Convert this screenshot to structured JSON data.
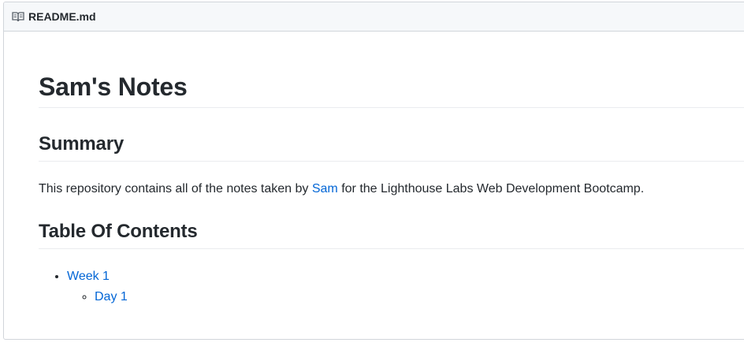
{
  "readme": {
    "filename": "README.md",
    "icon": "book-icon"
  },
  "content": {
    "title": "Sam's Notes",
    "summary_heading": "Summary",
    "summary_before": "This repository contains all of the notes taken by ",
    "summary_link": "Sam",
    "summary_after": " for the Lighthouse Labs Web Development Bootcamp.",
    "toc_heading": "Table Of Contents",
    "toc": [
      {
        "label": "Week 1",
        "children": [
          {
            "label": "Day 1"
          }
        ]
      }
    ]
  },
  "colors": {
    "link": "#0366d6",
    "text": "#24292e",
    "border": "#d1d5da",
    "header_bg": "#f6f8fa"
  }
}
